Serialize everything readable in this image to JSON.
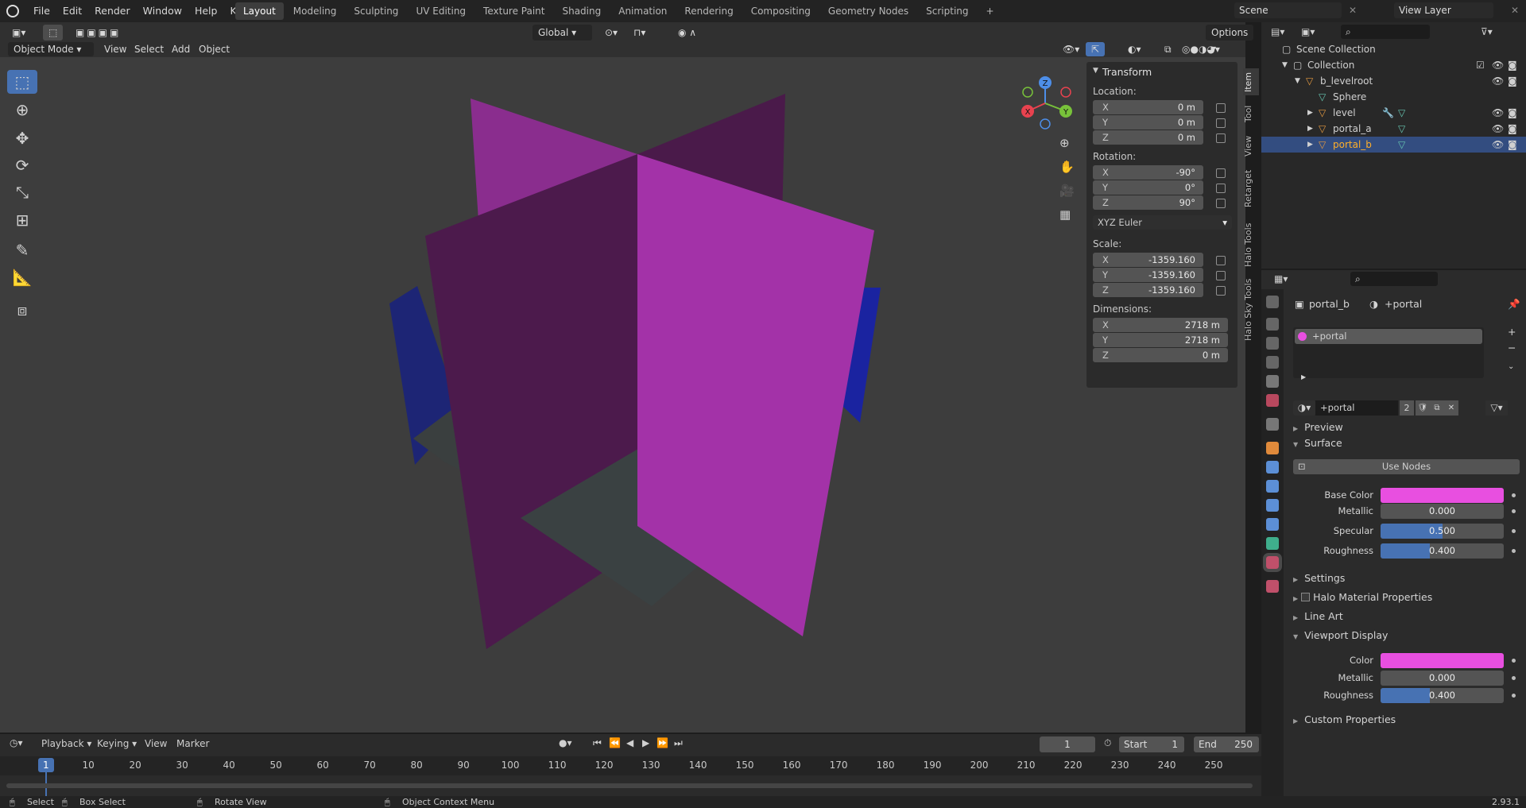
{
  "menus": [
    "File",
    "Edit",
    "Render",
    "Window",
    "Help",
    "Krieg"
  ],
  "workspaces": [
    "Layout",
    "Modeling",
    "Sculpting",
    "UV Editing",
    "Texture Paint",
    "Shading",
    "Animation",
    "Rendering",
    "Compositing",
    "Geometry Nodes",
    "Scripting"
  ],
  "scene": "Scene",
  "view_layer": "View Layer",
  "viewport": {
    "mode": "Object Mode",
    "menus": [
      "View",
      "Select",
      "Add",
      "Object"
    ],
    "orientation": "Global",
    "options": "Options",
    "gizmo": {
      "x": "X",
      "y": "Y",
      "z": "Z"
    }
  },
  "npanel": {
    "title": "Transform",
    "location_label": "Location:",
    "location": [
      {
        "ax": "X",
        "v": "0 m"
      },
      {
        "ax": "Y",
        "v": "0 m"
      },
      {
        "ax": "Z",
        "v": "0 m"
      }
    ],
    "rotation_label": "Rotation:",
    "rotation": [
      {
        "ax": "X",
        "v": "-90°"
      },
      {
        "ax": "Y",
        "v": "0°"
      },
      {
        "ax": "Z",
        "v": "90°"
      }
    ],
    "rotation_mode": "XYZ Euler",
    "scale_label": "Scale:",
    "scale": [
      {
        "ax": "X",
        "v": "-1359.160"
      },
      {
        "ax": "Y",
        "v": "-1359.160"
      },
      {
        "ax": "Z",
        "v": "-1359.160"
      }
    ],
    "dimensions_label": "Dimensions:",
    "dimensions": [
      {
        "ax": "X",
        "v": "2718 m"
      },
      {
        "ax": "Y",
        "v": "2718 m"
      },
      {
        "ax": "Z",
        "v": "0 m"
      }
    ],
    "tabs": [
      "Item",
      "Tool",
      "View",
      "Retarget",
      "Halo Tools",
      "Halo Sky Tools"
    ]
  },
  "outliner": {
    "root": "Scene Collection",
    "rows": [
      "Collection",
      "b_levelroot",
      "Sphere",
      "level",
      "portal_a",
      "portal_b"
    ]
  },
  "properties": {
    "object": "portal_b",
    "material": "+portal",
    "slot": "+portal",
    "material_field": "+portal",
    "users": "2",
    "sections": {
      "preview": "Preview",
      "surface": "Surface",
      "use_nodes": "Use Nodes",
      "settings": "Settings",
      "halo": "Halo Material Properties",
      "lineart": "Line Art",
      "viewport_display": "Viewport Display",
      "custom": "Custom Properties"
    },
    "surface": {
      "base_color_label": "Base Color",
      "metallic_label": "Metallic",
      "metallic": "0.000",
      "specular_label": "Specular",
      "specular": "0.500",
      "specular_frac": 0.5,
      "roughness_label": "Roughness",
      "roughness": "0.400",
      "roughness_frac": 0.4
    },
    "display": {
      "color_label": "Color",
      "metallic_label": "Metallic",
      "metallic": "0.000",
      "roughness_label": "Roughness",
      "roughness": "0.400",
      "roughness_frac": 0.4
    }
  },
  "colors": {
    "base_color": "#e84fe0",
    "accent": "#4772b3"
  },
  "timeline": {
    "menus": [
      "Playback",
      "Keying",
      "View",
      "Marker"
    ],
    "current_frame": "1",
    "start_label": "Start",
    "start": "1",
    "end_label": "End",
    "end": "250",
    "ticks": [
      "1",
      "10",
      "20",
      "30",
      "40",
      "50",
      "60",
      "70",
      "80",
      "90",
      "100",
      "110",
      "120",
      "130",
      "140",
      "150",
      "160",
      "170",
      "180",
      "190",
      "200",
      "210",
      "220",
      "230",
      "240",
      "250"
    ]
  },
  "status": {
    "select": "Select",
    "box_select": "Box Select",
    "rotate_view": "Rotate View",
    "context_menu": "Object Context Menu",
    "version": "2.93.1"
  }
}
